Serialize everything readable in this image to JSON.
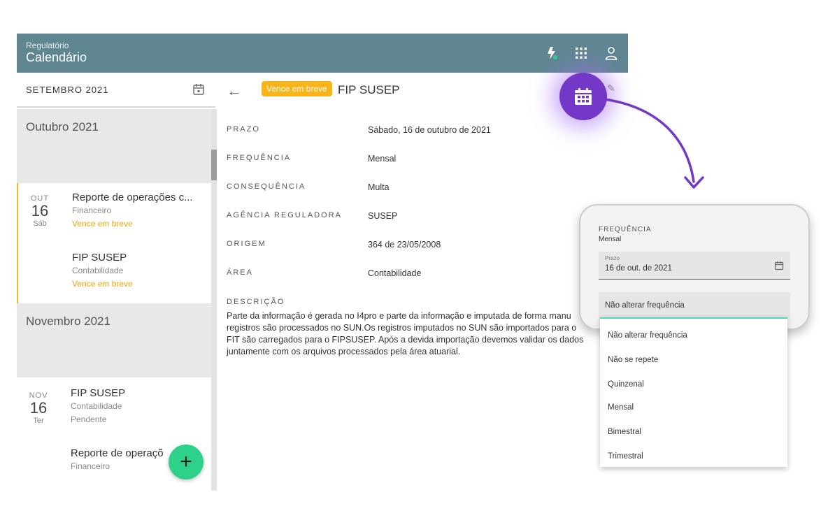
{
  "topbar": {
    "subtitle": "Regulatório",
    "title": "Calendário",
    "icons": [
      "bolt-notification-icon",
      "apps-grid-icon",
      "user-icon"
    ]
  },
  "left": {
    "month_selector": "SETEMBRO 2021",
    "months": [
      {
        "label": "Outubro 2021",
        "date": {
          "month": "OUT",
          "day": "16",
          "weekday": "Sáb"
        },
        "events": [
          {
            "title": "Reporte de operações c...",
            "category": "Financeiro",
            "status": "Vence em breve"
          },
          {
            "title": "FIP SUSEP",
            "category": "Contabilidade",
            "status": "Vence em breve"
          }
        ]
      },
      {
        "label": "Novembro 2021",
        "date": {
          "month": "NOV",
          "day": "16",
          "weekday": "Ter"
        },
        "events": [
          {
            "title": "FIP SUSEP",
            "category": "Contabilidade",
            "status": "Pendente"
          },
          {
            "title": "Reporte de operaçõ",
            "category": "Financeiro",
            "status": ""
          }
        ]
      }
    ],
    "fab_label": "+"
  },
  "detail": {
    "badge": "Vence em breve",
    "title": "FIP SUSEP",
    "fields": [
      {
        "label": "PRAZO",
        "value": "Sábado, 16 de outubro de 2021"
      },
      {
        "label": "FREQUÊNCIA",
        "value": "Mensal"
      },
      {
        "label": "CONSEQUÊNCIA",
        "value": "Multa"
      },
      {
        "label": "AGÊNCIA REGULADORA",
        "value": "SUSEP"
      },
      {
        "label": "ORIGEM",
        "value": "364 de 23/05/2008"
      },
      {
        "label": "ÁREA",
        "value": "Contabilidade"
      }
    ],
    "description_label": "DESCRIÇÃO",
    "description": "Parte da informação é gerada no I4pro e parte da informação e imputada de forma manu registros são processados no SUN.Os registros imputados no SUN são importados para o FIT são carregados para o FIPSUSEP. Após a devida importação devemos validar os dados juntamente com os arquivos processados pela área atuarial."
  },
  "zoom": {
    "freq_label": "FREQUÊNCIA",
    "freq_value": "Mensal",
    "prazo_label": "Prazo",
    "prazo_value": "16 de out. de 2021",
    "select_value": "Não alterar frequência",
    "options": [
      "Não alterar frequência",
      "Não se repete",
      "Quinzenal",
      "Mensal",
      "Bimestral",
      "Trimestral"
    ]
  },
  "colors": {
    "topbar": "#5f8690",
    "warning": "#f7b51a",
    "accent_purple": "#7438c8",
    "fab": "#2ed18a",
    "dropdown_focus": "#4fd6b6"
  }
}
